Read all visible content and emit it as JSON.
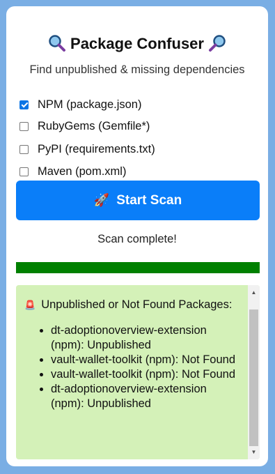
{
  "header": {
    "title": "Package Confuser",
    "left_icon": "magnifying-glass-icon",
    "right_icon": "magnifying-glass-icon",
    "subtitle": "Find unpublished & missing dependencies"
  },
  "options": [
    {
      "label": "NPM (package.json)",
      "checked": true
    },
    {
      "label": "RubyGems (Gemfile*)",
      "checked": false
    },
    {
      "label": "PyPI (requirements.txt)",
      "checked": false
    },
    {
      "label": "Maven (pom.xml)",
      "checked": false
    }
  ],
  "scan_button": {
    "label": "Start Scan",
    "icon": "rocket-icon",
    "color": "#0a7ef9"
  },
  "status": "Scan complete!",
  "progress": {
    "percent": 100,
    "color": "#008000"
  },
  "results": {
    "background": "#d4f1b8",
    "icon": "alarm-light-icon",
    "heading": "Unpublished or Not Found Packages:",
    "items": [
      "dt-adoptionoverview-extension (npm): Unpublished",
      "vault-wallet-toolkit (npm): Not Found",
      "vault-wallet-toolkit (npm): Not Found",
      "dt-adoptionoverview-extension (npm): Unpublished"
    ]
  }
}
